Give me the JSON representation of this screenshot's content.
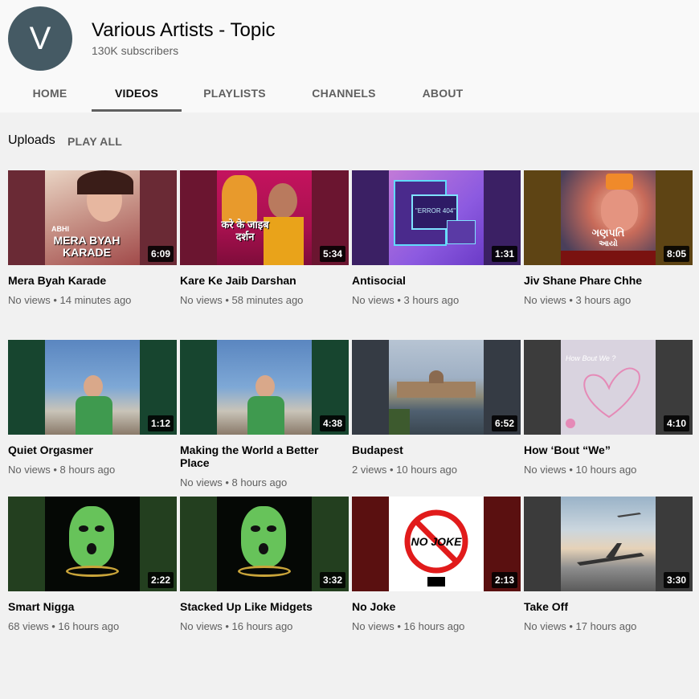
{
  "channel": {
    "avatar_letter": "V",
    "name": "Various Artists - Topic",
    "subscribers": "130K subscribers"
  },
  "tabs": [
    "HOME",
    "VIDEOS",
    "PLAYLISTS",
    "CHANNELS",
    "ABOUT"
  ],
  "section": {
    "title": "Uploads",
    "play_all": "PLAY ALL"
  },
  "videos": [
    {
      "title": "Mera Byah Karade",
      "duration": "6:09",
      "meta": "No views • 14 minutes ago",
      "art_text": "MERA BYAH KARADE",
      "art_small": "ABHI"
    },
    {
      "title": "Kare Ke Jaib Darshan",
      "duration": "5:34",
      "meta": "No views • 58 minutes ago",
      "art_text": "करे के जाइब दर्शन"
    },
    {
      "title": "Antisocial",
      "duration": "1:31",
      "meta": "No views • 3 hours ago",
      "art_text": "\"ERROR 404\""
    },
    {
      "title": "Jiv Shane Phare Chhe",
      "duration": "8:05",
      "meta": "No views • 3 hours ago",
      "art_text": "ગણપતિ",
      "art_small": "આયો"
    },
    {
      "title": "Quiet Orgasmer",
      "duration": "1:12",
      "meta": "No views • 8 hours ago"
    },
    {
      "title": "Making the World a Better Place",
      "duration": "4:38",
      "meta": "No views • 8 hours ago"
    },
    {
      "title": "Budapest",
      "duration": "6:52",
      "meta": "2 views • 10 hours ago"
    },
    {
      "title": "How ‘Bout “We”",
      "duration": "4:10",
      "meta": "No views • 10 hours ago",
      "art_text": "How Bout We ?"
    },
    {
      "title": "Smart Nigga",
      "duration": "2:22",
      "meta": "68 views • 16 hours ago"
    },
    {
      "title": "Stacked Up Like Midgets",
      "duration": "3:32",
      "meta": "No views • 16 hours ago"
    },
    {
      "title": "No Joke",
      "duration": "2:13",
      "meta": "No views • 16 hours ago",
      "art_text": "NO JOKE"
    },
    {
      "title": "Take Off",
      "duration": "3:30",
      "meta": "No views • 17 hours ago"
    }
  ],
  "colors": {
    "side_fill": [
      "#6a2a35",
      "#6b1530",
      "#3b2064",
      "#5e4414",
      "#17452f",
      "#17452f",
      "#353b44",
      "#3c3c3c",
      "#233f1f",
      "#233f1f",
      "#5a1010",
      "#3b3b3b"
    ]
  }
}
